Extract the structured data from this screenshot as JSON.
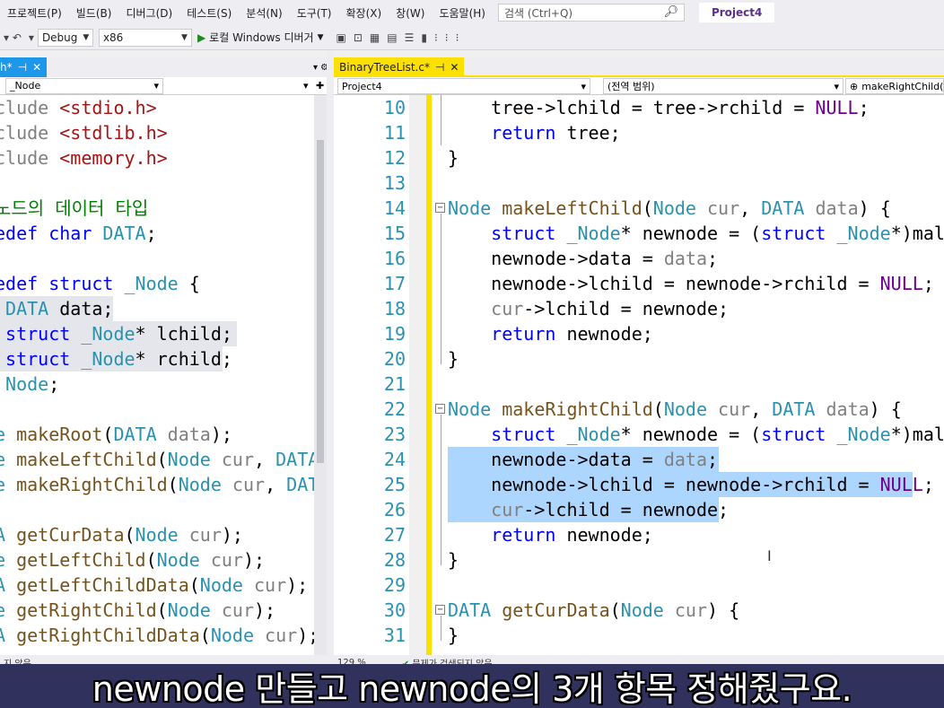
{
  "menu": [
    "프로젝트(P)",
    "빌드(B)",
    "디버그(D)",
    "테스트(S)",
    "분석(N)",
    "도구(T)",
    "확장(X)",
    "창(W)",
    "도움말(H)"
  ],
  "search_placeholder": "검색 (Ctrl+Q)",
  "project_name": "Project4",
  "toolbar": {
    "config": "Debug",
    "platform": "x86",
    "run_label": "로컬 Windows 디버거"
  },
  "left_panel": {
    "tab_label": "h*",
    "nav_value": "_Node",
    "status_text": "지 않음",
    "lines": [
      [
        [
          "pp",
          "clude "
        ],
        [
          "st",
          "<stdio.h>"
        ]
      ],
      [
        [
          "pp",
          "clude "
        ],
        [
          "st",
          "<stdlib.h>"
        ]
      ],
      [
        [
          "pp",
          "clude "
        ],
        [
          "st",
          "<memory.h>"
        ]
      ],
      [],
      [
        [
          "cm",
          "노드의 데이터 타입"
        ]
      ],
      [
        [
          "kw",
          "edef char "
        ],
        [
          "ty",
          "DATA"
        ],
        [
          "",
          "; "
        ]
      ],
      [],
      [
        [
          "kw",
          "edef struct "
        ],
        [
          "ty",
          "_Node"
        ],
        [
          "",
          " {"
        ]
      ],
      [
        [
          "",
          ""
        ],
        [
          "ty",
          " DATA"
        ],
        [
          "",
          " data;"
        ]
      ],
      [
        [
          "kw",
          " struct "
        ],
        [
          "ty",
          "_Node"
        ],
        [
          "",
          "* lchild;"
        ]
      ],
      [
        [
          "kw",
          " struct "
        ],
        [
          "ty",
          "_Node"
        ],
        [
          "",
          "* rchild;"
        ]
      ],
      [
        [
          "ty",
          " Node"
        ],
        [
          "",
          ";"
        ]
      ],
      [],
      [
        [
          "ty",
          "e"
        ],
        [
          "fn",
          " makeRoot"
        ],
        [
          "",
          "("
        ],
        [
          "ty",
          "DATA"
        ],
        [
          "pm",
          " data"
        ],
        [
          "",
          ");"
        ]
      ],
      [
        [
          "ty",
          "e"
        ],
        [
          "fn",
          " makeLeftChild"
        ],
        [
          "",
          "("
        ],
        [
          "ty",
          "Node"
        ],
        [
          "pm",
          " cur"
        ],
        [
          "",
          ", "
        ],
        [
          "ty",
          "DATA"
        ]
      ],
      [
        [
          "ty",
          "e"
        ],
        [
          "fn",
          " makeRightChild"
        ],
        [
          "",
          "("
        ],
        [
          "ty",
          "Node"
        ],
        [
          "pm",
          " cur"
        ],
        [
          "",
          ", "
        ],
        [
          "ty",
          "DATA"
        ]
      ],
      [],
      [
        [
          "ty",
          "A"
        ],
        [
          "fn",
          " getCurData"
        ],
        [
          "",
          "("
        ],
        [
          "ty",
          "Node"
        ],
        [
          "pm",
          " cur"
        ],
        [
          "",
          ");"
        ]
      ],
      [
        [
          "ty",
          "e"
        ],
        [
          "fn",
          " getLeftChild"
        ],
        [
          "",
          "("
        ],
        [
          "ty",
          "Node"
        ],
        [
          "pm",
          " cur"
        ],
        [
          "",
          ");"
        ]
      ],
      [
        [
          "ty",
          "A"
        ],
        [
          "fn",
          " getLeftChildData"
        ],
        [
          "",
          "("
        ],
        [
          "ty",
          "Node"
        ],
        [
          "pm",
          " cur"
        ],
        [
          "",
          ");"
        ]
      ],
      [
        [
          "ty",
          "e"
        ],
        [
          "fn",
          " getRightChild"
        ],
        [
          "",
          "("
        ],
        [
          "ty",
          "Node"
        ],
        [
          "pm",
          " cur"
        ],
        [
          "",
          ");"
        ]
      ],
      [
        [
          "ty",
          "A"
        ],
        [
          "fn",
          " getRightChildData"
        ],
        [
          "",
          "("
        ],
        [
          "ty",
          "Node"
        ],
        [
          "pm",
          " cur"
        ],
        [
          "",
          ");"
        ]
      ]
    ]
  },
  "editor": {
    "file_tab": "BinaryTreeList.c*",
    "nav_project": "Project4",
    "nav_scope": "(전역 범위)",
    "nav_function": "makeRightChild(N",
    "zoom": "129 %",
    "status_issue": "문제가 검색되지 않음",
    "line_numbers": [
      "10",
      "11",
      "12",
      "13",
      "14",
      "15",
      "16",
      "17",
      "18",
      "19",
      "20",
      "21",
      "22",
      "23",
      "24",
      "25",
      "26",
      "27",
      "28",
      "29",
      "30",
      "31"
    ],
    "lines": [
      [
        [
          "",
          "    tree->lchild = tree->rchild = "
        ],
        [
          "mc",
          "NULL"
        ],
        [
          "",
          ";"
        ]
      ],
      [
        [
          "kw",
          "    return"
        ],
        [
          "",
          " tree;"
        ]
      ],
      [
        [
          "",
          "}"
        ]
      ],
      [],
      [
        [
          "ty",
          "Node"
        ],
        [
          "fn",
          " makeLeftChild"
        ],
        [
          "",
          "("
        ],
        [
          "ty",
          "Node"
        ],
        [
          "pm",
          " cur"
        ],
        [
          "",
          ", "
        ],
        [
          "ty",
          "DATA"
        ],
        [
          "pm",
          " data"
        ],
        [
          "",
          ") {"
        ]
      ],
      [
        [
          "kw",
          "    struct"
        ],
        [
          "ty",
          " _Node"
        ],
        [
          "",
          "* newnode = ("
        ],
        [
          "kw",
          "struct"
        ],
        [
          "ty",
          " _Node"
        ],
        [
          "",
          "*)mallo"
        ]
      ],
      [
        [
          "",
          "    newnode->data = "
        ],
        [
          "pm",
          "data"
        ],
        [
          "",
          ";"
        ]
      ],
      [
        [
          "",
          "    newnode->lchild = newnode->rchild = "
        ],
        [
          "mc",
          "NULL"
        ],
        [
          "",
          ";"
        ]
      ],
      [
        [
          "",
          "    "
        ],
        [
          "pm",
          "cur"
        ],
        [
          "",
          "->lchild = newnode;"
        ]
      ],
      [
        [
          "kw",
          "    return"
        ],
        [
          "",
          " newnode;"
        ]
      ],
      [
        [
          "",
          "}"
        ]
      ],
      [],
      [
        [
          "ty",
          "Node"
        ],
        [
          "fn",
          " makeRightChild"
        ],
        [
          "",
          "("
        ],
        [
          "ty",
          "Node"
        ],
        [
          "pm",
          " cur"
        ],
        [
          "",
          ", "
        ],
        [
          "ty",
          "DATA"
        ],
        [
          "pm",
          " data"
        ],
        [
          "",
          ") {"
        ]
      ],
      [
        [
          "kw",
          "    struct"
        ],
        [
          "ty",
          " _Node"
        ],
        [
          "",
          "* newnode = ("
        ],
        [
          "kw",
          "struct"
        ],
        [
          "ty",
          " _Node"
        ],
        [
          "",
          "*)mallo"
        ]
      ],
      [
        [
          "",
          "    newnode->data = "
        ],
        [
          "pm",
          "data"
        ],
        [
          "",
          ";"
        ]
      ],
      [
        [
          "",
          "    newnode->lchild = newnode->rchild = "
        ],
        [
          "mc",
          "NULL"
        ],
        [
          "",
          ";"
        ]
      ],
      [
        [
          "",
          "    "
        ],
        [
          "pm",
          "cur"
        ],
        [
          "",
          "->lchild = newnode;"
        ]
      ],
      [
        [
          "kw",
          "    return"
        ],
        [
          "",
          " newnode;"
        ]
      ],
      [
        [
          "",
          "}"
        ]
      ],
      [],
      [
        [
          "ty",
          "DATA"
        ],
        [
          "fn",
          " getCurData"
        ],
        [
          "",
          "("
        ],
        [
          "ty",
          "Node"
        ],
        [
          "pm",
          " cur"
        ],
        [
          "",
          ") {"
        ]
      ],
      [
        [
          "",
          "}"
        ]
      ]
    ]
  },
  "subtitle": "newnode 만들고 newnode의 3개 항목 정해줬구요."
}
